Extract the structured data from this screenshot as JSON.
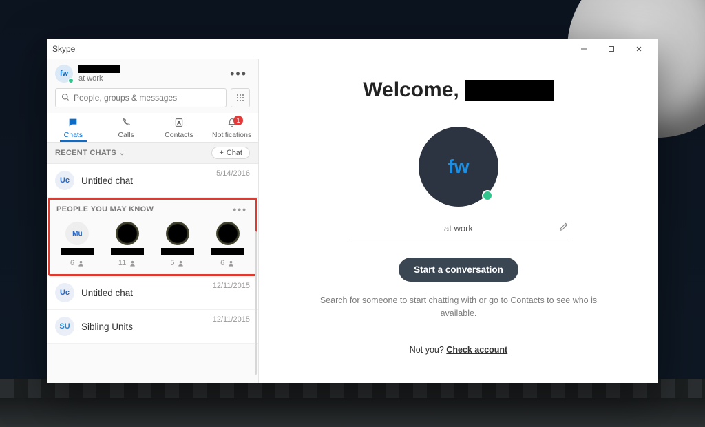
{
  "window": {
    "title": "Skype"
  },
  "profile": {
    "initials": "fw",
    "status_text": "at work"
  },
  "search": {
    "placeholder": "People, groups & messages"
  },
  "tabs": {
    "chats": "Chats",
    "calls": "Calls",
    "contacts": "Contacts",
    "notifications": "Notifications",
    "notif_badge": "1"
  },
  "sections": {
    "recent": "RECENT CHATS",
    "chat_button": "Chat",
    "pymk": "PEOPLE YOU MAY KNOW"
  },
  "recent_chats": [
    {
      "avatar": "Uc",
      "title": "Untitled chat",
      "date": "5/14/2016"
    },
    {
      "avatar": "Uc",
      "title": "Untitled chat",
      "date": "12/11/2015"
    },
    {
      "avatar": "SU",
      "title": "Sibling Units",
      "date": "12/11/2015"
    }
  ],
  "suggestions": [
    {
      "avatar_text": "Mu",
      "avatar_dark": false,
      "mutuals": "6"
    },
    {
      "avatar_text": "",
      "avatar_dark": true,
      "mutuals": "11"
    },
    {
      "avatar_text": "",
      "avatar_dark": true,
      "mutuals": "5"
    },
    {
      "avatar_text": "",
      "avatar_dark": true,
      "mutuals": "6"
    }
  ],
  "main": {
    "welcome_prefix": "Welcome,",
    "avatar_initials": "fw",
    "status": "at work",
    "cta": "Start a conversation",
    "hint": "Search for someone to start chatting with or go to Contacts to see who is available.",
    "notyou_prefix": "Not you? ",
    "notyou_link": "Check account"
  }
}
